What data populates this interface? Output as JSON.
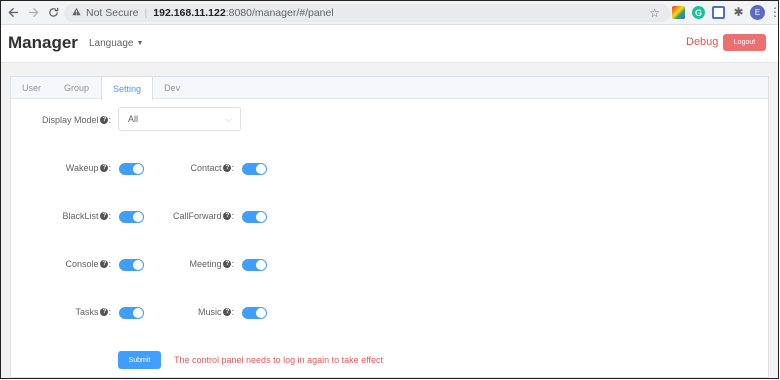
{
  "browser": {
    "security_label": "Not Secure",
    "url_host": "192.168.11.122",
    "url_path": ":8080/manager/#/panel",
    "profile_initial": "E"
  },
  "header": {
    "brand": "Manager",
    "language_label": "Language",
    "debug_label": "Debug",
    "logout_label": "Logout"
  },
  "tabs": [
    {
      "label": "User",
      "active": false
    },
    {
      "label": "Group",
      "active": false
    },
    {
      "label": "Setting",
      "active": true
    },
    {
      "label": "Dev",
      "active": false
    }
  ],
  "settings": {
    "display_model": {
      "label": "Display Model",
      "value": "All"
    },
    "toggles": [
      {
        "label": "Wakeup",
        "on": true
      },
      {
        "label": "Contact",
        "on": true
      },
      {
        "label": "BlackList",
        "on": true
      },
      {
        "label": "CallForward",
        "on": true
      },
      {
        "label": "Console",
        "on": true
      },
      {
        "label": "Meeting",
        "on": true
      },
      {
        "label": "Tasks",
        "on": true
      },
      {
        "label": "Music",
        "on": true
      }
    ],
    "colon": ":",
    "help_glyph": "?"
  },
  "form": {
    "submit_label": "Submit",
    "note": "The control panel needs to log in again to take effect"
  },
  "colors": {
    "accent": "#409eff",
    "danger": "#e84f4f",
    "logout_bg": "#ec7070"
  }
}
